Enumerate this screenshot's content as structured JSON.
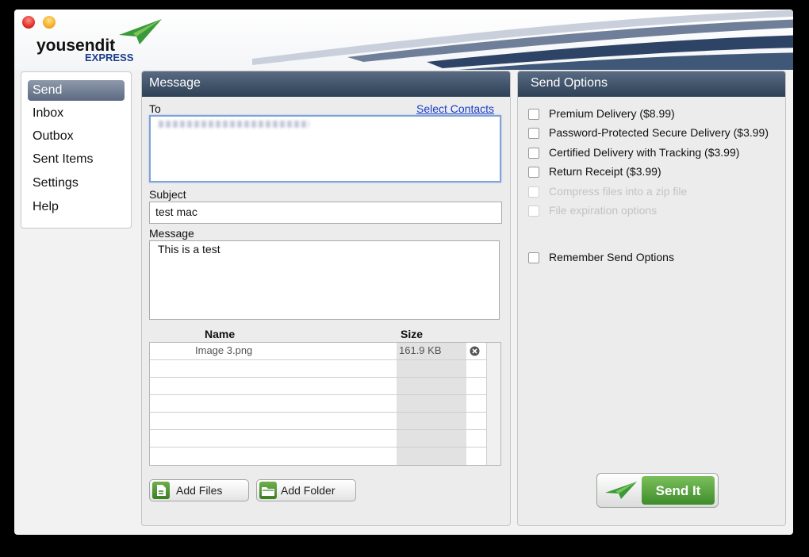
{
  "app": {
    "logo_word": "yousendit",
    "logo_sub": "EXPRESS"
  },
  "colors": {
    "panel_header": "#2f4157",
    "link": "#1a3acb",
    "send_green": "#4f9f35",
    "nav_active": "#6b7890"
  },
  "sidebar": {
    "items": [
      {
        "label": "Send",
        "active": true
      },
      {
        "label": "Inbox",
        "active": false
      },
      {
        "label": "Outbox",
        "active": false
      },
      {
        "label": "Sent Items",
        "active": false
      },
      {
        "label": "Settings",
        "active": false
      },
      {
        "label": "Help",
        "active": false
      }
    ]
  },
  "message_panel": {
    "title": "Message",
    "to_label": "To",
    "select_contacts": "Select Contacts",
    "subject_label": "Subject",
    "subject_value": "test mac",
    "message_label": "Message",
    "message_value": "This is a test",
    "files": {
      "col_name": "Name",
      "col_size": "Size",
      "rows": [
        {
          "name": "Image 3.png",
          "size": "161.9 KB"
        }
      ]
    },
    "add_files_label": "Add Files",
    "add_folder_label": "Add Folder"
  },
  "send_options": {
    "title": "Send Options",
    "options": [
      {
        "label": "Premium Delivery ($8.99)",
        "checked": false,
        "enabled": true
      },
      {
        "label": "Password-Protected Secure Delivery ($3.99)",
        "checked": false,
        "enabled": true
      },
      {
        "label": "Certified Delivery with Tracking ($3.99)",
        "checked": false,
        "enabled": true
      },
      {
        "label": "Return Receipt ($3.99)",
        "checked": false,
        "enabled": true
      },
      {
        "label": "Compress files into a zip file",
        "checked": false,
        "enabled": false
      },
      {
        "label": "File expiration options",
        "checked": false,
        "enabled": false
      }
    ],
    "remember_label": "Remember Send Options",
    "send_button": "Send It"
  }
}
